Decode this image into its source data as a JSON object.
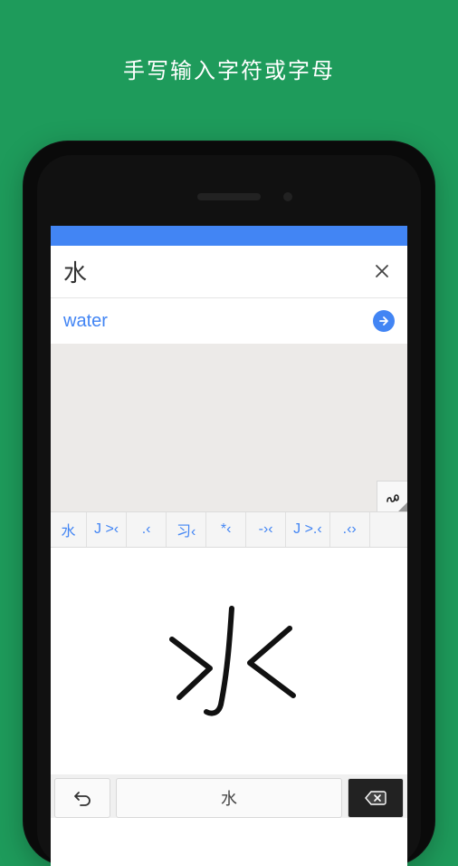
{
  "promo": {
    "text": "手写输入字符或字母"
  },
  "input": {
    "value": "水"
  },
  "result": {
    "text": "water"
  },
  "icons": {
    "clear": "close-icon",
    "go": "arrow-right-icon",
    "handwrite": "scribble-icon"
  },
  "suggestions": [
    {
      "label": "水"
    },
    {
      "label": "J >‹"
    },
    {
      "label": ".‹"
    },
    {
      "label": "习‹"
    },
    {
      "label": "*‹"
    },
    {
      "label": "-›‹"
    },
    {
      "label": "J >.‹"
    },
    {
      "label": ".‹›"
    }
  ],
  "handwriting": {
    "char": "水"
  },
  "bottom": {
    "left": "↺",
    "space": "水",
    "delete": "⌫"
  }
}
